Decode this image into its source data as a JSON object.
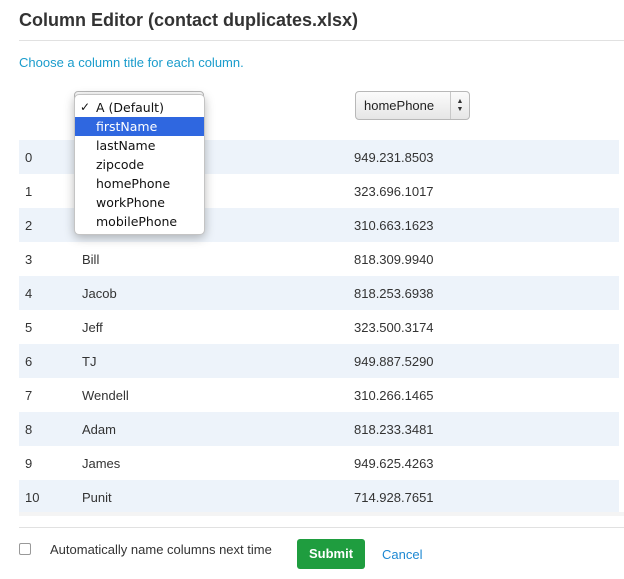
{
  "window": {
    "title": "Column Editor (contact duplicates.xlsx)",
    "instruction": "Choose a column title for each column."
  },
  "column_selects": {
    "col1_selected": "A (Default)",
    "col2_selected": "homePhone"
  },
  "dropdown": {
    "options": [
      {
        "label": "A (Default)",
        "checked": true,
        "highlighted": false
      },
      {
        "label": "firstName",
        "checked": false,
        "highlighted": true
      },
      {
        "label": "lastName",
        "checked": false,
        "highlighted": false
      },
      {
        "label": "zipcode",
        "checked": false,
        "highlighted": false
      },
      {
        "label": "homePhone",
        "checked": false,
        "highlighted": false
      },
      {
        "label": "workPhone",
        "checked": false,
        "highlighted": false
      },
      {
        "label": "mobilePhone",
        "checked": false,
        "highlighted": false
      }
    ],
    "check_glyph": "✓"
  },
  "rows": [
    {
      "index": "0",
      "name": "",
      "phone": "949.231.8503"
    },
    {
      "index": "1",
      "name": "",
      "phone": "323.696.1017"
    },
    {
      "index": "2",
      "name": "",
      "phone": "310.663.1623"
    },
    {
      "index": "3",
      "name": "Bill",
      "phone": "818.309.9940"
    },
    {
      "index": "4",
      "name": "Jacob",
      "phone": "818.253.6938"
    },
    {
      "index": "5",
      "name": "Jeff",
      "phone": "323.500.3174"
    },
    {
      "index": "6",
      "name": "TJ",
      "phone": "949.887.5290"
    },
    {
      "index": "7",
      "name": "Wendell",
      "phone": "310.266.1465"
    },
    {
      "index": "8",
      "name": "Adam",
      "phone": "818.233.3481"
    },
    {
      "index": "9",
      "name": "James",
      "phone": "949.625.4263"
    },
    {
      "index": "10",
      "name": "Punit",
      "phone": "714.928.7651"
    }
  ],
  "footer": {
    "auto_name_label": "Automatically name columns next time",
    "auto_name_checked": false,
    "submit_label": "Submit",
    "cancel_label": "Cancel"
  },
  "colors": {
    "accent_link": "#1a9ccc",
    "submit_bg": "#1f9d3f",
    "row_stripe": "#edf3fa",
    "dropdown_highlight": "#2f67e0"
  }
}
